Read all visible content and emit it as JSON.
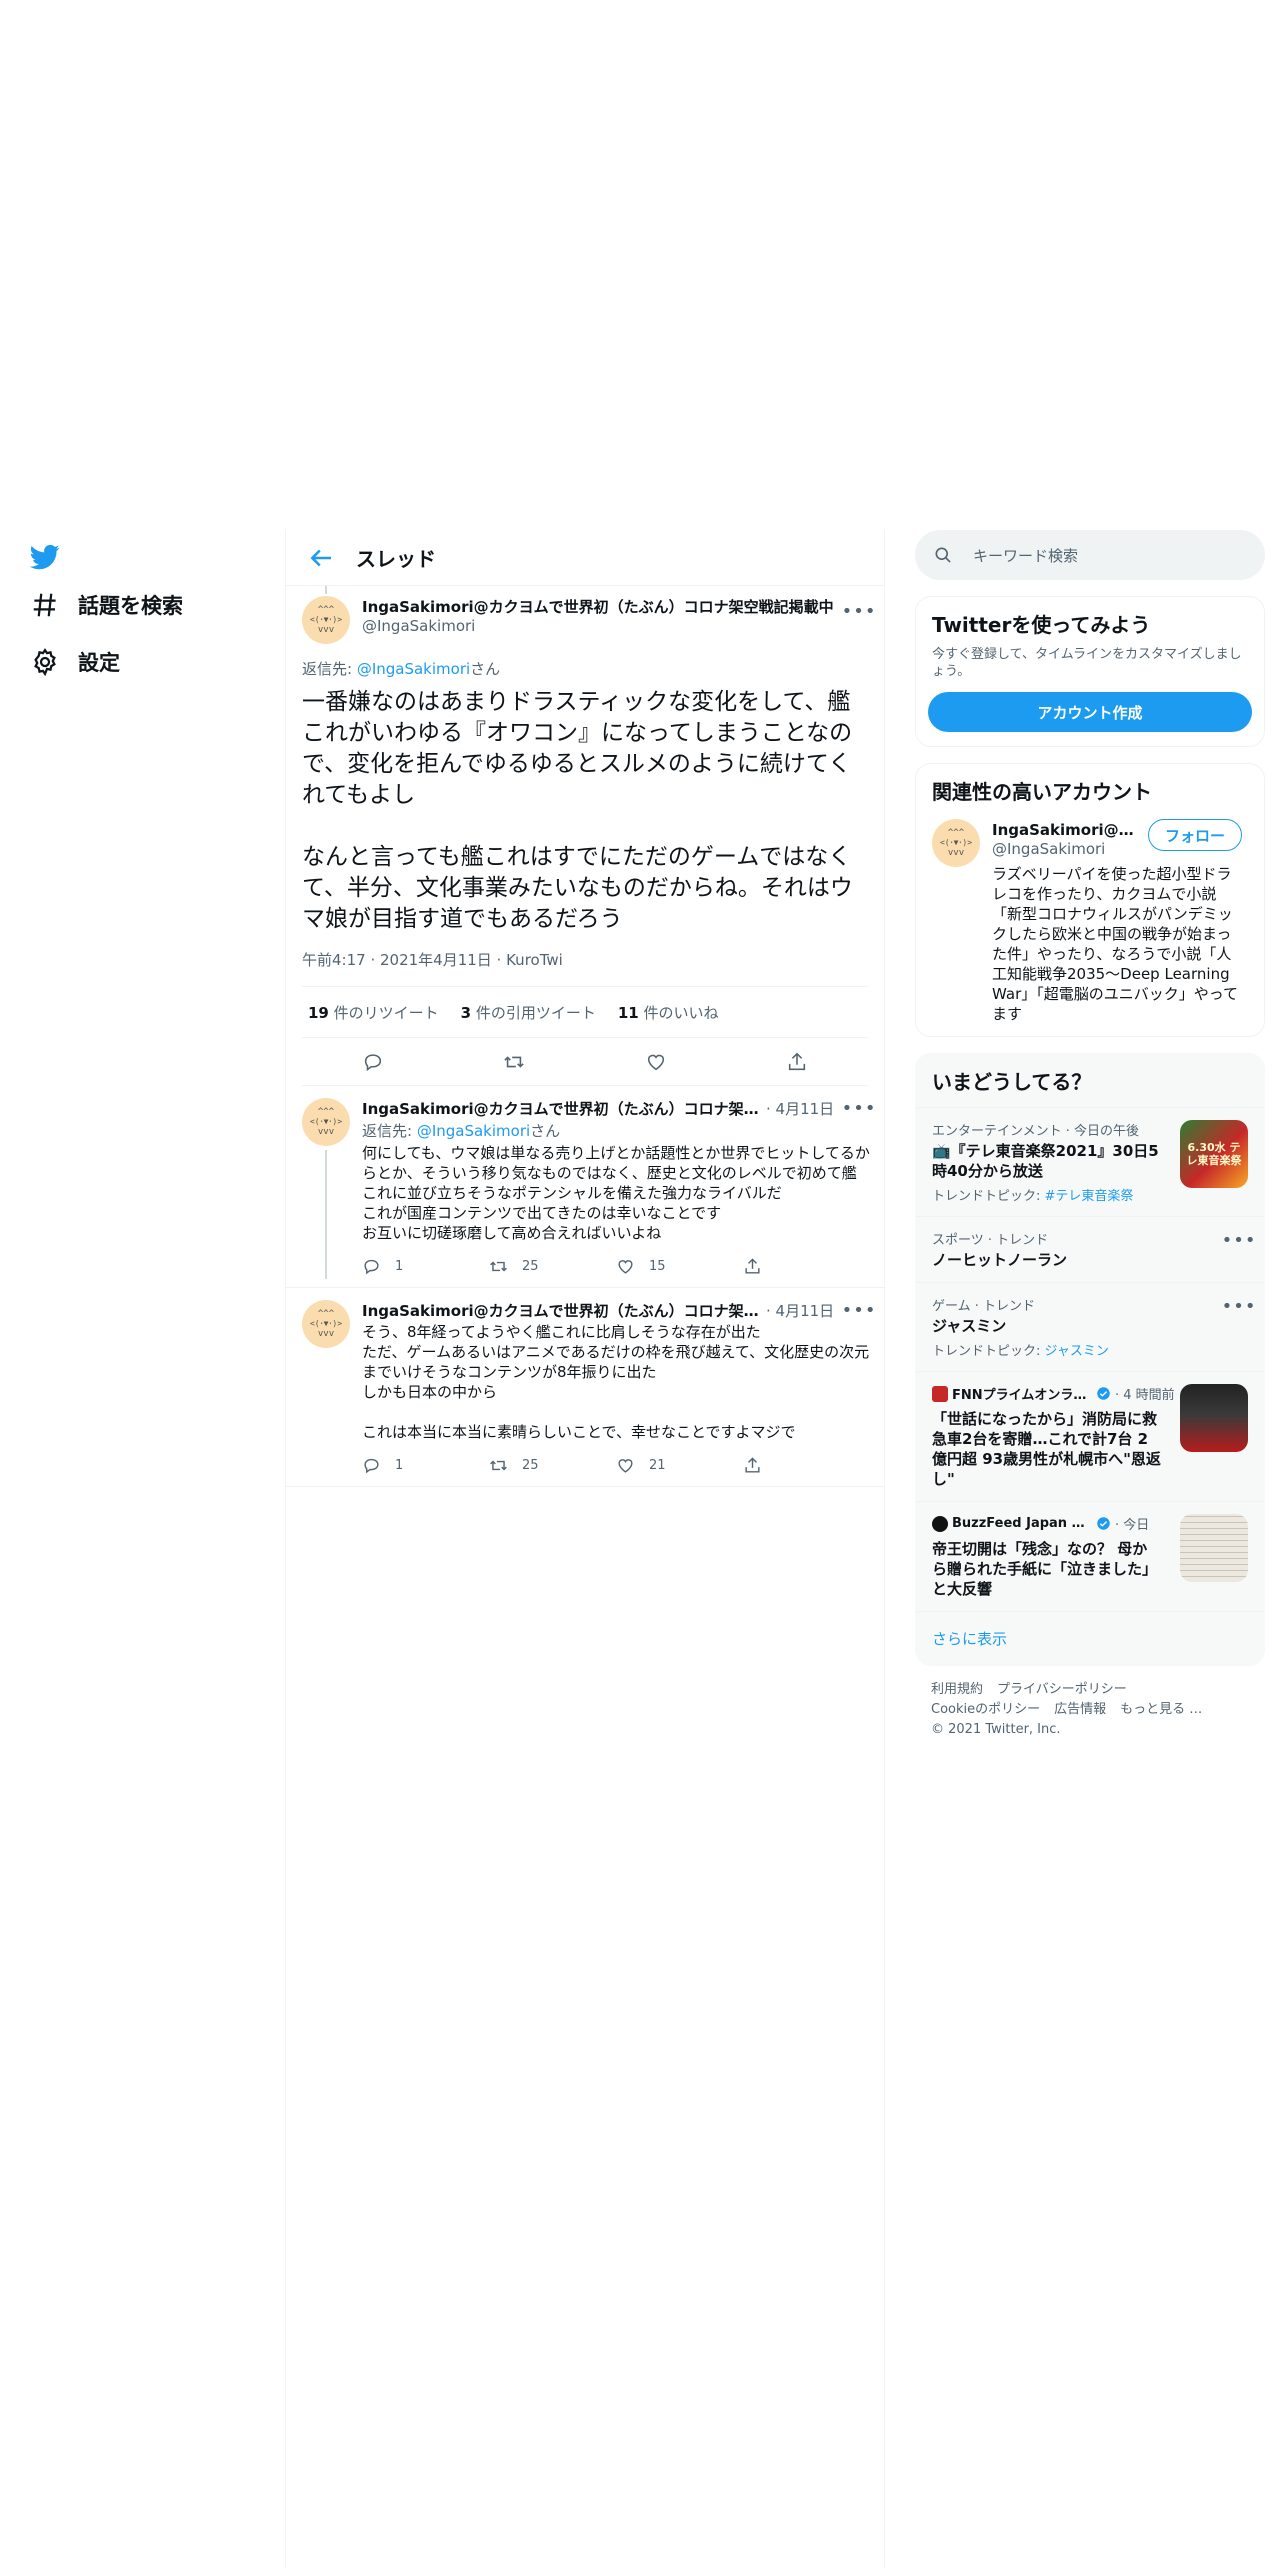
{
  "nav": {
    "items": [
      {
        "label": "話題を検索",
        "icon": "hashtag-icon"
      },
      {
        "label": "設定",
        "icon": "gear-icon"
      }
    ]
  },
  "header": {
    "title": "スレッド"
  },
  "main_tweet": {
    "display_name": "IngaSakimori@カクヨムで世界初（たぶん）コロナ架空戦記掲載中",
    "handle": "@IngaSakimori",
    "reply_prefix": "返信先: ",
    "reply_to": "@IngaSakimori",
    "reply_suffix": "さん",
    "text": "一番嫌なのはあまりドラスティックな変化をして、艦これがいわゆる『オワコン』になってしまうことなので、変化を拒んでゆるゆるとスルメのように続けてくれてもよし\n\nなんと言っても艦これはすでにただのゲームではなくて、半分、文化事業みたいなものだからね。それはウマ娘が目指す道でもあるだろう",
    "meta": "午前4:17 · 2021年4月11日 · KuroTwi",
    "retweets_count": "19",
    "retweets_label": " 件のリツイート",
    "quotes_count": "3",
    "quotes_label": " 件の引用ツイート",
    "likes_count": "11",
    "likes_label": " 件のいいね"
  },
  "replies": [
    {
      "display_name": "IngaSakimori@カクヨムで世界初（たぶん）コロナ架空戦記掲載中",
      "time": "· 4月11日",
      "reply_prefix": "返信先: ",
      "reply_to": "@IngaSakimori",
      "reply_suffix": "さん",
      "text": "何にしても、ウマ娘は単なる売り上げとか話題性とか世界でヒットしてるからとか、そういう移り気なものではなく、歴史と文化のレベルで初めて艦これに並び立ちそうなポテンシャルを備えた強力なライバルだ\nこれが国産コンテンツで出てきたのは幸いなことです\nお互いに切磋琢磨して高め合えればいいよね",
      "replies": "1",
      "retweets": "25",
      "likes": "15"
    },
    {
      "display_name": "IngaSakimori@カクヨムで世界初（たぶん）コロナ架空戦記掲載中",
      "time": "· 4月11日",
      "text": "そう、8年経ってようやく艦これに比肩しそうな存在が出た\nただ、ゲームあるいはアニメであるだけの枠を飛び越えて、文化歴史の次元までいけそうなコンテンツが8年振りに出た\nしかも日本の中から\n\nこれは本当に本当に素晴らしいことで、幸せなことですよマジで",
      "replies": "1",
      "retweets": "25",
      "likes": "21"
    }
  ],
  "search": {
    "placeholder": "キーワード検索"
  },
  "try_twitter": {
    "title": "Twitterを使ってみよう",
    "description": "今すぐ登録して、タイムラインをカスタマイズしましょう。",
    "button": "アカウント作成"
  },
  "relevant": {
    "title": "関連性の高いアカウント",
    "display_name": "IngaSakimori@カクヨムで世界初（たぶん）コロナ架空戦記掲載中",
    "handle": "@IngaSakimori",
    "follow": "フォロー",
    "bio": "ラズベリーパイを使った超小型ドラレコを作ったり、カクヨムで小説「新型コロナウィルスがパンデミックしたら欧米と中国の戦争が始まった件」やったり、なろうで小説「人工知能戦争2035～Deep Learning War」「超電脳のユニバック」やってます"
  },
  "trends": {
    "title": "いまどうしてる？",
    "items": [
      {
        "category": "エンターテインメント · 今日の午後",
        "title": "📺『テレ東音楽祭2021』30日5時40分から放送",
        "sub_prefix": "トレンドトピック: ",
        "sub_link": "#テレ東音楽祭",
        "image": "6.30水 テレ東音楽祭"
      },
      {
        "category": "スポーツ · トレンド",
        "title": "ノーヒットノーラン"
      },
      {
        "category": "ゲーム · トレンド",
        "title": "ジャスミン ",
        "sub_prefix": "トレンドトピック: ",
        "sub_link": "ジャスミン"
      },
      {
        "source": "FNNプライムオンライン",
        "time": "· 4 時間前",
        "title": "「世話になったから」消防局に救急車2台を寄贈…これで計7台 2億円超 93歳男性が札幌市へ\"恩返し\""
      },
      {
        "source": "BuzzFeed Japan News",
        "time": "· 今日",
        "title": "帝王切開は「残念」なの？ 母から贈られた手紙に「泣きました」と大反響"
      }
    ],
    "show_more": "さらに表示"
  },
  "footer": {
    "terms": "利用規約",
    "privacy": "プライバシーポリシー",
    "cookies": "Cookieのポリシー",
    "ads": "広告情報",
    "more": "もっと見る …",
    "copyright": "© 2021 Twitter, Inc."
  },
  "colors": {
    "accent": "#1d9bf0",
    "text": "#0f1419",
    "secondary": "#536471",
    "border": "#eff3f4"
  }
}
